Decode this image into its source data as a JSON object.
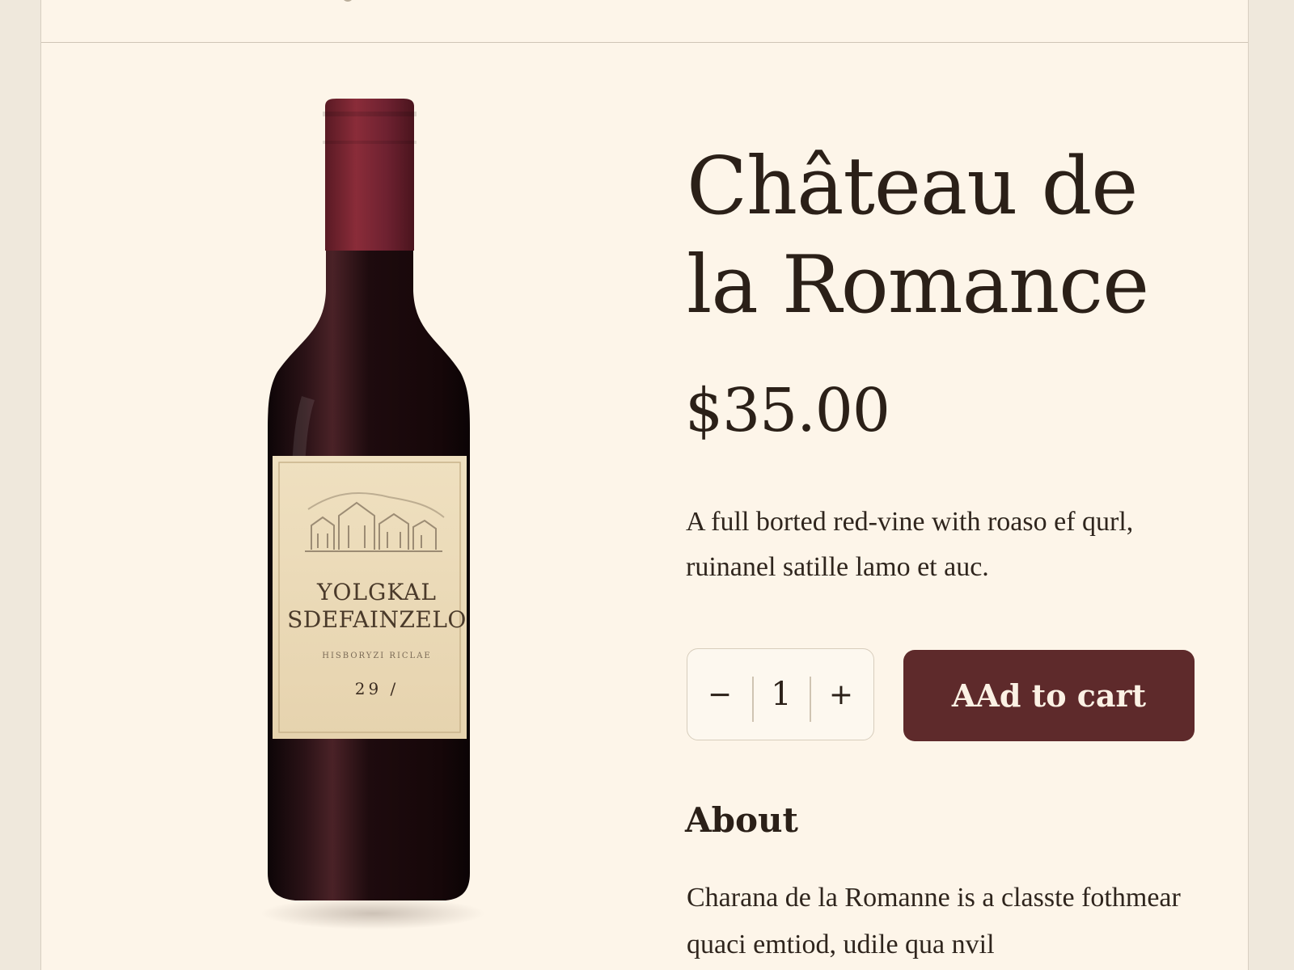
{
  "product": {
    "title": "Château de la Romance",
    "price": "$35.00",
    "description": "A full borted red-vine with roaso ef qurl, ruinanel satille lamo et auc.",
    "quantity": "1",
    "quantity_minus": "−",
    "quantity_plus": "+",
    "add_to_cart_label": "AAd to cart"
  },
  "bottle_label": {
    "line1": "YOLGKAL",
    "line2": "SDEFAINZELO",
    "small": "HISBORYZI RICLAE",
    "year": "29 /"
  },
  "about": {
    "heading": "About",
    "text": "Charana de la Romanne is a classte fothmear quaci emtiod, udile qua nvil"
  },
  "colors": {
    "accent": "#5e2a2b",
    "background": "#fdf5e9",
    "capsule": "#7a2431",
    "bottle": "#1a0c0f"
  },
  "icons": {
    "minus": "minus-icon",
    "plus": "plus-icon"
  }
}
